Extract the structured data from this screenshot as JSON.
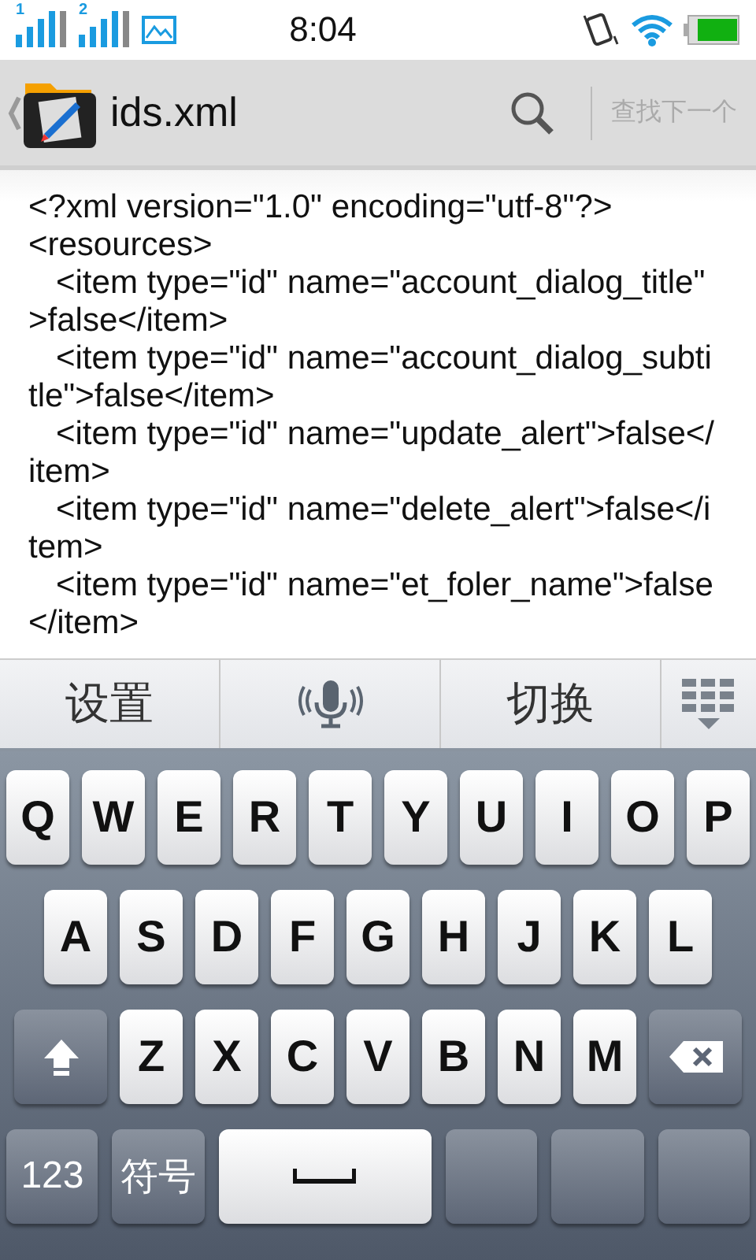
{
  "status_bar": {
    "time": "8:04",
    "sims": [
      "1",
      "2"
    ]
  },
  "title_bar": {
    "file_name": "ids.xml",
    "find_next": "查找下一个"
  },
  "code_lines": [
    "<?xml version=\"1.0\" encoding=\"utf-8\"?>",
    "<resources>",
    "   <item type=\"id\" name=\"account_dialog_title\"",
    ">false</item>",
    "   <item type=\"id\" name=\"account_dialog_subti",
    "tle\">false</item>",
    "   <item type=\"id\" name=\"update_alert\">false</",
    "item>",
    "   <item type=\"id\" name=\"delete_alert\">false</i",
    "tem>",
    "   <item type=\"id\" name=\"et_foler_name\">false",
    "</item>"
  ],
  "candidate_bar": [
    {
      "kind": "text",
      "label": "设置"
    },
    {
      "kind": "mic"
    },
    {
      "kind": "text",
      "label": "切换"
    },
    {
      "kind": "grid"
    }
  ],
  "keyboard_rows": [
    [
      {
        "kind": "letter",
        "label": "Q"
      },
      {
        "kind": "letter",
        "label": "W"
      },
      {
        "kind": "letter",
        "label": "E"
      },
      {
        "kind": "letter",
        "label": "R"
      },
      {
        "kind": "letter",
        "label": "T"
      },
      {
        "kind": "letter",
        "label": "Y"
      },
      {
        "kind": "letter",
        "label": "U"
      },
      {
        "kind": "letter",
        "label": "I"
      },
      {
        "kind": "letter",
        "label": "O"
      },
      {
        "kind": "letter",
        "label": "P"
      }
    ],
    [
      {
        "kind": "letter",
        "label": "A"
      },
      {
        "kind": "letter",
        "label": "S"
      },
      {
        "kind": "letter",
        "label": "D"
      },
      {
        "kind": "letter",
        "label": "F"
      },
      {
        "kind": "letter",
        "label": "G"
      },
      {
        "kind": "letter",
        "label": "H"
      },
      {
        "kind": "letter",
        "label": "J"
      },
      {
        "kind": "letter",
        "label": "K"
      },
      {
        "kind": "letter",
        "label": "L"
      }
    ],
    [
      {
        "kind": "shift"
      },
      {
        "kind": "letter",
        "label": "Z"
      },
      {
        "kind": "letter",
        "label": "X"
      },
      {
        "kind": "letter",
        "label": "C"
      },
      {
        "kind": "letter",
        "label": "V"
      },
      {
        "kind": "letter",
        "label": "B"
      },
      {
        "kind": "letter",
        "label": "N"
      },
      {
        "kind": "letter",
        "label": "M"
      },
      {
        "kind": "backspace"
      }
    ],
    [
      {
        "kind": "function",
        "label": "123"
      },
      {
        "kind": "function",
        "label": "符号"
      },
      {
        "kind": "space"
      },
      {
        "kind": "function"
      },
      {
        "kind": "function"
      },
      {
        "kind": "function"
      }
    ]
  ]
}
